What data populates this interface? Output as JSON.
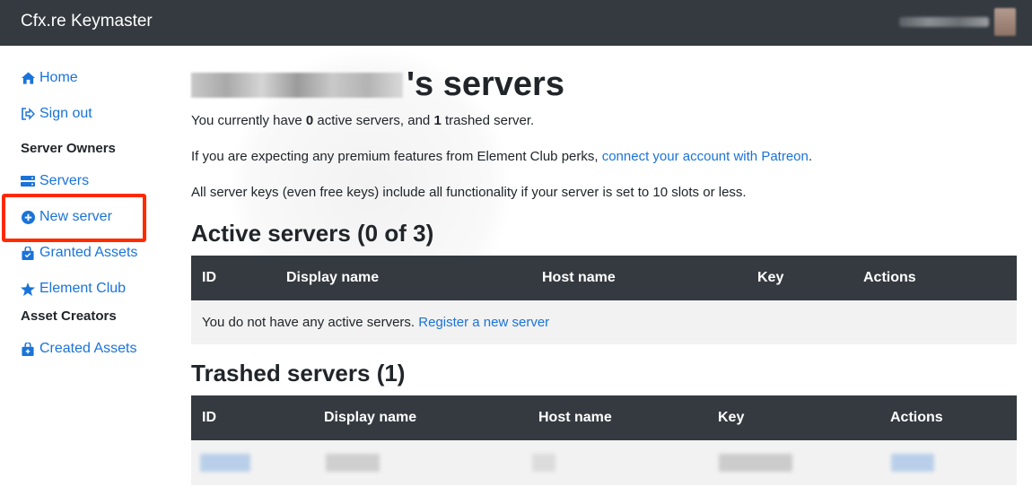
{
  "app": {
    "brand": "Cfx.re Keymaster"
  },
  "sidebar": {
    "items": [
      {
        "label": "Home",
        "icon": "home-icon"
      },
      {
        "label": "Sign out",
        "icon": "sign-out-icon"
      },
      {
        "heading": "Server Owners"
      },
      {
        "label": "Servers",
        "icon": "servers-icon"
      },
      {
        "label": "New server",
        "icon": "plus-circle-icon"
      },
      {
        "label": "Granted Assets",
        "icon": "shopping-bag-icon"
      },
      {
        "label": "Element Club",
        "icon": "star-icon"
      },
      {
        "heading": "Asset Creators"
      },
      {
        "label": "Created Assets",
        "icon": "shopping-bag-icon"
      }
    ]
  },
  "page": {
    "title_suffix": "'s servers",
    "summary": {
      "prefix": "You currently have ",
      "active_count": "0",
      "middle": " active servers, and ",
      "trashed_count": "1",
      "suffix": " trashed server."
    },
    "patreon": {
      "text": "If you are expecting any premium features from Element Club perks, ",
      "link": "connect your account with Patreon",
      "end": "."
    },
    "keys_note": "All server keys (even free keys) include all functionality if your server is set to 10 slots or less."
  },
  "active": {
    "title": "Active servers (0 of 3)",
    "headers": [
      "ID",
      "Display name",
      "Host name",
      "Key",
      "Actions"
    ],
    "empty_text": "You do not have any active servers. ",
    "empty_link": "Register a new server"
  },
  "trashed": {
    "title": "Trashed servers (1)",
    "headers": [
      "ID",
      "Display name",
      "Host name",
      "Key",
      "Actions"
    ]
  },
  "colors": {
    "navbar": "#343a40",
    "link": "#1a73d8",
    "highlight": "#ff2a00",
    "row_bg": "#f2f2f2"
  }
}
